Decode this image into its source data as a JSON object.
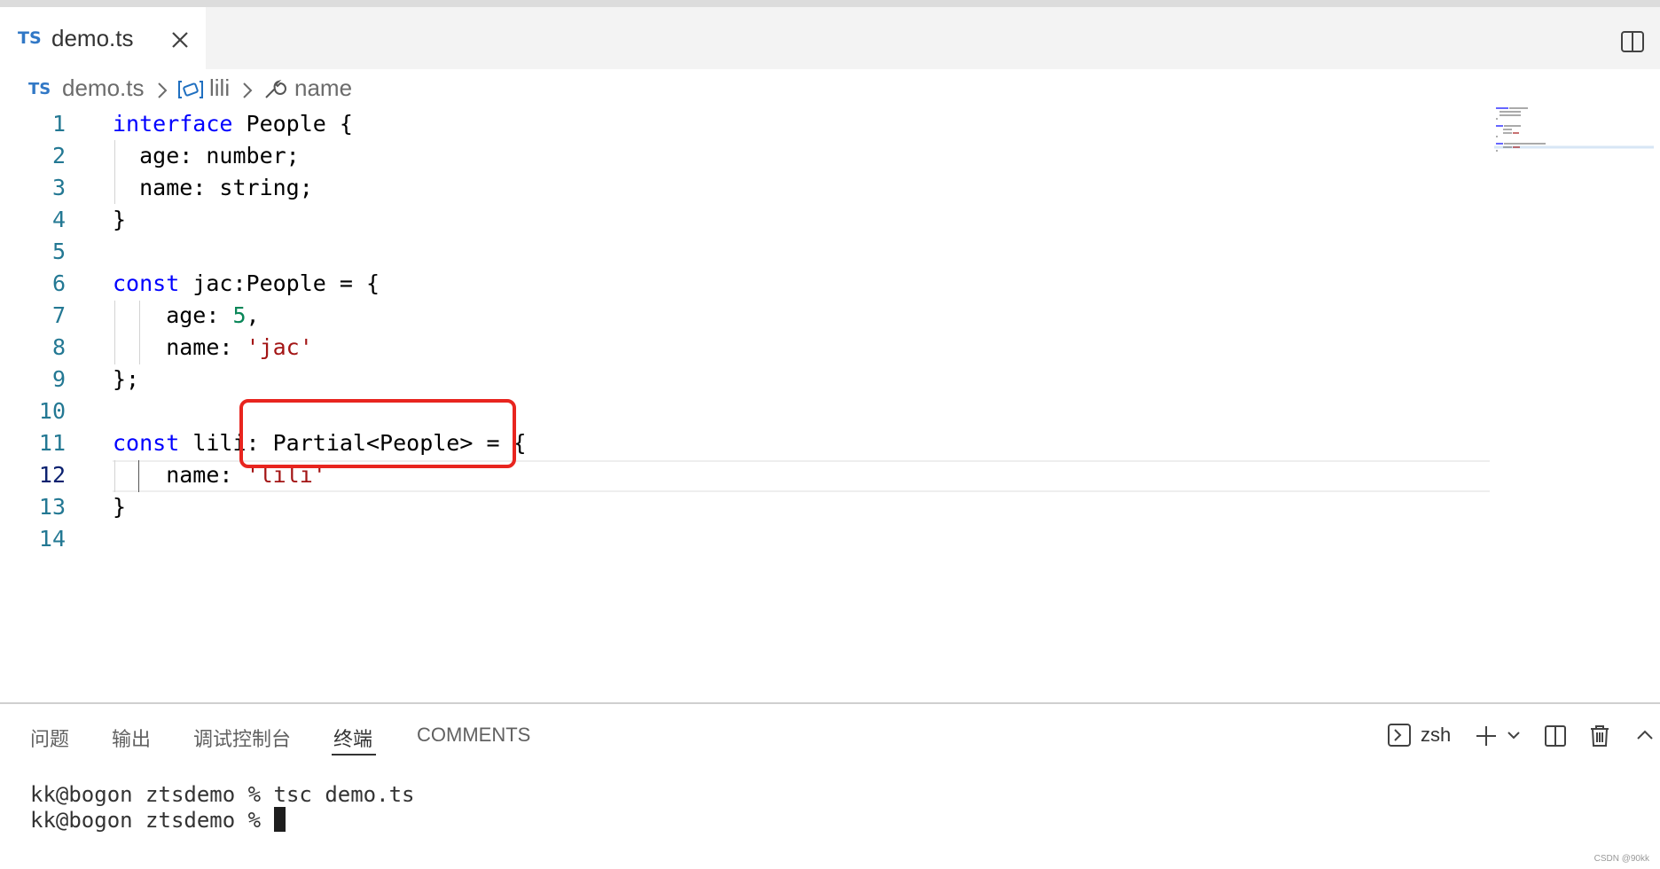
{
  "tab": {
    "lang": "TS",
    "filename": "demo.ts"
  },
  "breadcrumb": {
    "lang": "TS",
    "file": "demo.ts",
    "symbol": "lili",
    "property": "name"
  },
  "editor": {
    "lines": [
      {
        "n": "1",
        "parts": [
          {
            "t": "interface",
            "c": "kw"
          },
          {
            "t": " People {",
            "c": ""
          }
        ]
      },
      {
        "n": "2",
        "parts": [
          {
            "t": "  age: number;",
            "c": ""
          }
        ]
      },
      {
        "n": "3",
        "parts": [
          {
            "t": "  name: string;",
            "c": ""
          }
        ]
      },
      {
        "n": "4",
        "parts": [
          {
            "t": "}",
            "c": ""
          }
        ]
      },
      {
        "n": "5",
        "parts": []
      },
      {
        "n": "6",
        "parts": [
          {
            "t": "const",
            "c": "kw"
          },
          {
            "t": " jac:People = {",
            "c": ""
          }
        ]
      },
      {
        "n": "7",
        "parts": [
          {
            "t": "    age: ",
            "c": ""
          },
          {
            "t": "5",
            "c": "num"
          },
          {
            "t": ",",
            "c": ""
          }
        ]
      },
      {
        "n": "8",
        "parts": [
          {
            "t": "    name: ",
            "c": ""
          },
          {
            "t": "'jac'",
            "c": "str"
          }
        ]
      },
      {
        "n": "9",
        "parts": [
          {
            "t": "};",
            "c": ""
          }
        ]
      },
      {
        "n": "10",
        "parts": []
      },
      {
        "n": "11",
        "parts": [
          {
            "t": "const",
            "c": "kw"
          },
          {
            "t": " lili: Partial<People> = {",
            "c": ""
          }
        ]
      },
      {
        "n": "12",
        "parts": [
          {
            "t": "    name: ",
            "c": ""
          },
          {
            "t": "'lili'",
            "c": "str"
          }
        ]
      },
      {
        "n": "13",
        "parts": [
          {
            "t": "}",
            "c": ""
          }
        ]
      },
      {
        "n": "14",
        "parts": []
      }
    ],
    "active_line": "12"
  },
  "panel": {
    "tabs": [
      "问题",
      "输出",
      "调试控制台",
      "终端",
      "COMMENTS"
    ],
    "active_tab": "终端",
    "shell_label": "zsh"
  },
  "terminal": {
    "line1": "kk@bogon ztsdemo % tsc demo.ts",
    "line2": "kk@bogon ztsdemo % "
  },
  "watermark": "CSDN @90kk",
  "colors": {
    "keyword": "#0000ff",
    "number": "#098658",
    "string": "#a31515",
    "line_number": "#237893",
    "highlight_box": "#e8251f"
  }
}
